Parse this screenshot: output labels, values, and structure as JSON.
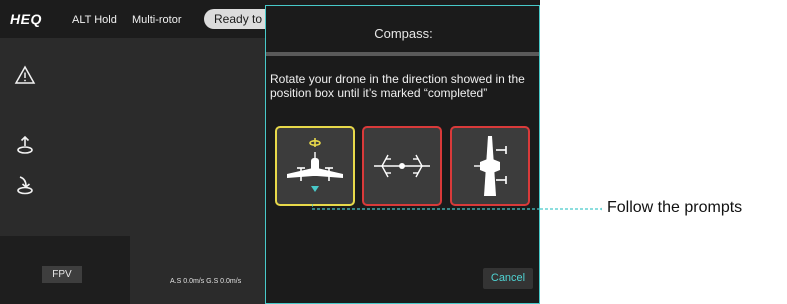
{
  "topbar": {
    "logo": "HEQ",
    "flight_mode": "ALT Hold",
    "frame_type": "Multi-rotor",
    "status": "Ready to ta"
  },
  "side_buttons": [
    "warning-icon",
    "takeoff-icon",
    "land-icon"
  ],
  "bottom": {
    "fpv_label": "FPV",
    "speed": "A.S 0.0m/s   G.S 0.0m/s"
  },
  "dialog": {
    "title": "Compass:",
    "instruction_line1": "Rotate your drone in the direction showed in the",
    "instruction_line2": "position box until it’s marked “completed”",
    "positions": [
      {
        "state": "current",
        "border_color": "#e8d94a"
      },
      {
        "state": "pending",
        "border_color": "#d93a3a"
      },
      {
        "state": "pending",
        "border_color": "#d93a3a"
      }
    ],
    "cancel_label": "Cancel"
  },
  "annotation": {
    "text": "Follow the prompts",
    "color": "#48c9c9"
  }
}
